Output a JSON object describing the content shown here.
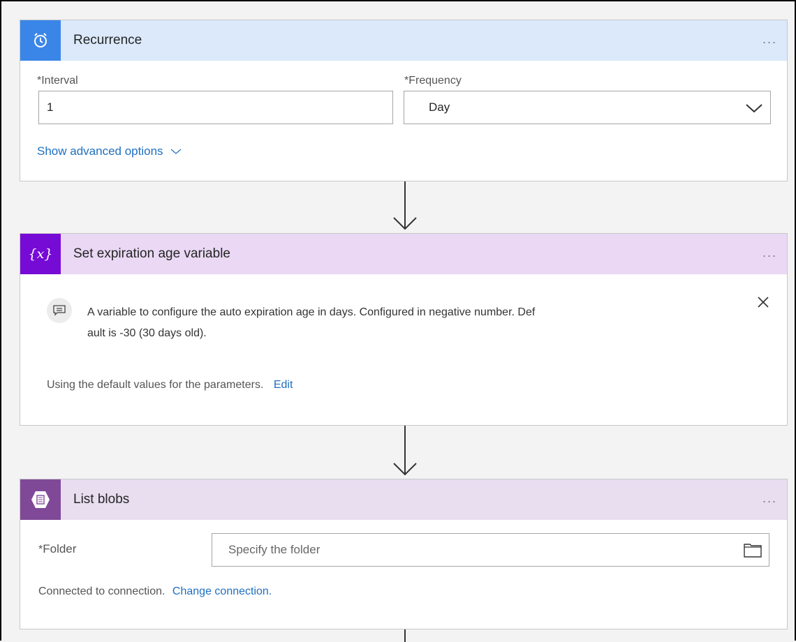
{
  "recurrence": {
    "title": "Recurrence",
    "more": "...",
    "interval_label": "Interval",
    "interval_value": "1",
    "frequency_label": "Frequency",
    "frequency_value": "Day",
    "advanced_link": "Show advanced options",
    "header_color": "#dbe9fb",
    "icon_color": "#3a86e8"
  },
  "set_variable": {
    "title": "Set expiration age variable",
    "more": "...",
    "icon_text": "{x}",
    "comment_line1": "A variable to configure the auto expiration age in days. Configured in negative number. Def",
    "comment_line2": "ault is -30 (30 days old).",
    "default_text": "Using the default values for the parameters.",
    "edit_link": "Edit",
    "header_color": "#ead8f4",
    "icon_color": "#770bd6"
  },
  "list_blobs": {
    "title": "List blobs",
    "more": "...",
    "folder_label": "Folder",
    "folder_placeholder": "Specify the folder",
    "connection_text": "Connected to connection.",
    "change_link": "Change connection.",
    "header_color": "#e8def0",
    "icon_color": "#804998"
  },
  "required_mark": "*"
}
